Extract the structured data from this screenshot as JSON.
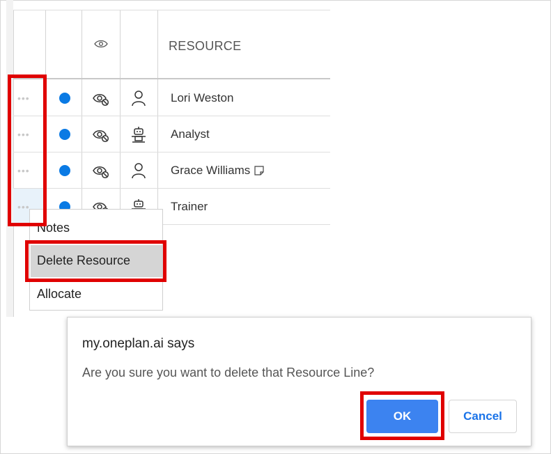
{
  "grid": {
    "header": {
      "resource_label": "RESOURCE",
      "eye_icon": "eye-icon"
    },
    "rows": [
      {
        "name": "Lori Weston",
        "status_color": "#0a7ae4",
        "visibility_icon": "eye-slash-icon",
        "type_icon": "person-icon",
        "has_note": false
      },
      {
        "name": "Analyst",
        "status_color": "#0a7ae4",
        "visibility_icon": "eye-slash-icon",
        "type_icon": "robot-icon",
        "has_note": false
      },
      {
        "name": "Grace Williams",
        "status_color": "#0a7ae4",
        "visibility_icon": "eye-slash-icon",
        "type_icon": "person-icon",
        "has_note": true
      },
      {
        "name": "Trainer",
        "status_color": "#0a7ae4",
        "visibility_icon": "eye-slash-icon",
        "type_icon": "robot-icon",
        "has_note": false
      }
    ]
  },
  "context_menu": {
    "items": [
      {
        "label": "Notes"
      },
      {
        "label": "Delete Resource",
        "highlighted": true
      },
      {
        "label": "Allocate"
      }
    ]
  },
  "dialog": {
    "title": "my.oneplan.ai says",
    "message": "Are you sure you want to delete that Resource Line?",
    "ok_label": "OK",
    "cancel_label": "Cancel"
  },
  "colors": {
    "accent": "#3c83f0",
    "highlight_box": "#e00000",
    "status_dot": "#0a7ae4"
  }
}
